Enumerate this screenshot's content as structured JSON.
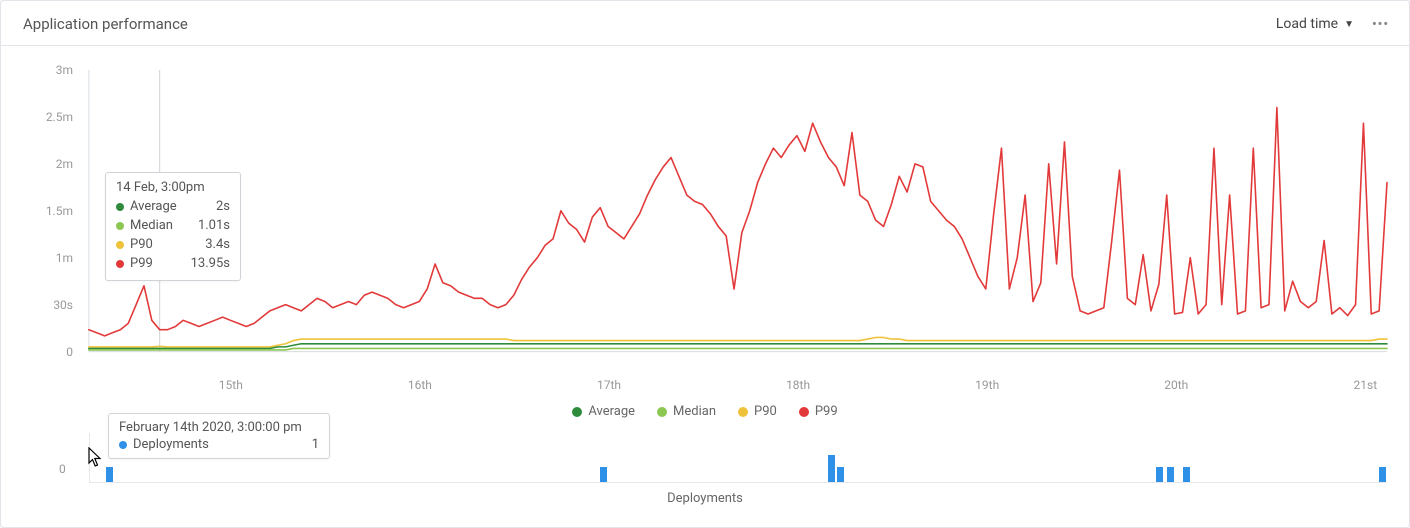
{
  "header": {
    "title": "Application performance",
    "dropdown_label": "Load time"
  },
  "legend": [
    {
      "label": "Average",
      "color": "#2e8b3c"
    },
    {
      "label": "Median",
      "color": "#8cc751"
    },
    {
      "label": "P90",
      "color": "#eec33a"
    },
    {
      "label": "P99",
      "color": "#e23a3a"
    }
  ],
  "y_ticks": [
    "0",
    "30s",
    "1m",
    "1.5m",
    "2m",
    "2.5m",
    "3m"
  ],
  "x_ticks": [
    "15th",
    "16th",
    "17th",
    "18th",
    "19th",
    "20th",
    "21st"
  ],
  "tooltip_main": {
    "heading": "14 Feb, 3:00pm",
    "rows": [
      {
        "label": "Average",
        "value": "2s",
        "color": "#2e8b3c"
      },
      {
        "label": "Median",
        "value": "1.01s",
        "color": "#8cc751"
      },
      {
        "label": "P90",
        "value": "3.4s",
        "color": "#eec33a"
      },
      {
        "label": "P99",
        "value": "13.95s",
        "color": "#e23a3a"
      }
    ]
  },
  "deployments": {
    "axis_label": "0",
    "title": "Deployments",
    "bars": [
      {
        "pos": 0.012,
        "h": 0.55
      },
      {
        "pos": 0.393,
        "h": 0.55
      },
      {
        "pos": 0.569,
        "h": 1.0
      },
      {
        "pos": 0.576,
        "h": 0.55
      },
      {
        "pos": 0.822,
        "h": 0.55
      },
      {
        "pos": 0.83,
        "h": 0.55
      },
      {
        "pos": 0.843,
        "h": 0.55
      },
      {
        "pos": 0.994,
        "h": 0.55
      }
    ]
  },
  "tooltip_deploy": {
    "heading": "February 14th 2020, 3:00:00 pm",
    "label": "Deployments",
    "value": "1"
  },
  "chart_data": {
    "type": "line",
    "title": "Application performance — Load time",
    "xlabel": "",
    "ylabel": "Load time",
    "y_ticks_seconds": [
      0,
      30,
      60,
      90,
      120,
      150,
      180
    ],
    "ylim": [
      0,
      180
    ],
    "x": [
      "14 Feb 06:00",
      "14 Feb 07:00",
      "14 Feb 08:00",
      "14 Feb 09:00",
      "14 Feb 10:00",
      "14 Feb 11:00",
      "14 Feb 12:00",
      "14 Feb 13:00",
      "14 Feb 14:00",
      "14 Feb 15:00",
      "14 Feb 16:00",
      "14 Feb 17:00",
      "14 Feb 18:00",
      "14 Feb 19:00",
      "14 Feb 20:00",
      "14 Feb 21:00",
      "14 Feb 22:00",
      "14 Feb 23:00",
      "15 Feb 00:00",
      "15 Feb 01:00",
      "15 Feb 02:00",
      "15 Feb 03:00",
      "15 Feb 04:00",
      "15 Feb 05:00",
      "15 Feb 06:00",
      "15 Feb 07:00",
      "15 Feb 08:00",
      "15 Feb 09:00",
      "15 Feb 10:00",
      "15 Feb 11:00",
      "15 Feb 12:00",
      "15 Feb 13:00",
      "15 Feb 14:00",
      "15 Feb 15:00",
      "15 Feb 16:00",
      "15 Feb 17:00",
      "15 Feb 18:00",
      "15 Feb 19:00",
      "15 Feb 20:00",
      "15 Feb 21:00",
      "15 Feb 22:00",
      "15 Feb 23:00",
      "16 Feb 00:00",
      "16 Feb 01:00",
      "16 Feb 02:00",
      "16 Feb 03:00",
      "16 Feb 04:00",
      "16 Feb 05:00",
      "16 Feb 06:00",
      "16 Feb 07:00",
      "16 Feb 08:00",
      "16 Feb 09:00",
      "16 Feb 10:00",
      "16 Feb 11:00",
      "16 Feb 12:00",
      "16 Feb 13:00",
      "16 Feb 14:00",
      "16 Feb 15:00",
      "16 Feb 16:00",
      "16 Feb 17:00",
      "16 Feb 18:00",
      "16 Feb 19:00",
      "16 Feb 20:00",
      "16 Feb 21:00",
      "16 Feb 22:00",
      "16 Feb 23:00",
      "17 Feb 00:00",
      "17 Feb 01:00",
      "17 Feb 02:00",
      "17 Feb 03:00",
      "17 Feb 04:00",
      "17 Feb 05:00",
      "17 Feb 06:00",
      "17 Feb 07:00",
      "17 Feb 08:00",
      "17 Feb 09:00",
      "17 Feb 10:00",
      "17 Feb 11:00",
      "17 Feb 12:00",
      "17 Feb 13:00",
      "17 Feb 14:00",
      "17 Feb 15:00",
      "17 Feb 16:00",
      "17 Feb 17:00",
      "17 Feb 18:00",
      "17 Feb 19:00",
      "17 Feb 20:00",
      "17 Feb 21:00",
      "17 Feb 22:00",
      "17 Feb 23:00",
      "18 Feb 00:00",
      "18 Feb 01:00",
      "18 Feb 02:00",
      "18 Feb 03:00",
      "18 Feb 04:00",
      "18 Feb 05:00",
      "18 Feb 06:00",
      "18 Feb 07:00",
      "18 Feb 08:00",
      "18 Feb 09:00",
      "18 Feb 10:00",
      "18 Feb 11:00",
      "18 Feb 12:00",
      "18 Feb 13:00",
      "18 Feb 14:00",
      "18 Feb 15:00",
      "18 Feb 16:00",
      "18 Feb 17:00",
      "18 Feb 18:00",
      "18 Feb 19:00",
      "18 Feb 20:00",
      "18 Feb 21:00",
      "18 Feb 22:00",
      "18 Feb 23:00",
      "19 Feb 00:00",
      "19 Feb 01:00",
      "19 Feb 02:00",
      "19 Feb 03:00",
      "19 Feb 04:00",
      "19 Feb 05:00",
      "19 Feb 06:00",
      "19 Feb 07:00",
      "19 Feb 08:00",
      "19 Feb 09:00",
      "19 Feb 10:00",
      "19 Feb 11:00",
      "19 Feb 12:00",
      "19 Feb 13:00",
      "19 Feb 14:00",
      "19 Feb 15:00",
      "19 Feb 16:00",
      "19 Feb 17:00",
      "19 Feb 18:00",
      "19 Feb 19:00",
      "19 Feb 20:00",
      "19 Feb 21:00",
      "19 Feb 22:00",
      "19 Feb 23:00",
      "20 Feb 00:00",
      "20 Feb 01:00",
      "20 Feb 02:00",
      "20 Feb 03:00",
      "20 Feb 04:00",
      "20 Feb 05:00",
      "20 Feb 06:00",
      "20 Feb 07:00",
      "20 Feb 08:00",
      "20 Feb 09:00",
      "20 Feb 10:00",
      "20 Feb 11:00",
      "20 Feb 12:00",
      "20 Feb 13:00",
      "20 Feb 14:00",
      "20 Feb 15:00",
      "20 Feb 16:00",
      "20 Feb 17:00",
      "20 Feb 18:00",
      "20 Feb 19:00",
      "20 Feb 20:00",
      "20 Feb 21:00",
      "20 Feb 22:00",
      "20 Feb 23:00",
      "21 Feb 00:00",
      "21 Feb 01:00",
      "21 Feb 02:00",
      "21 Feb 03:00"
    ],
    "series": [
      {
        "name": "Average",
        "color": "#2e8b3c",
        "values": [
          2,
          2,
          2,
          2,
          2,
          2,
          2,
          2,
          2,
          2,
          2,
          2,
          2,
          2,
          2,
          2,
          2,
          2,
          2,
          2,
          2,
          2,
          2,
          2,
          3,
          3,
          4,
          5,
          5,
          5,
          5,
          5,
          5,
          5,
          5,
          5,
          5,
          5,
          5,
          5,
          5,
          5,
          5,
          5,
          5,
          5,
          5,
          5,
          5,
          5,
          5,
          5,
          5,
          5,
          5,
          5,
          5,
          5,
          5,
          5,
          5,
          5,
          5,
          5,
          5,
          5,
          5,
          5,
          5,
          5,
          5,
          5,
          5,
          5,
          5,
          5,
          5,
          5,
          5,
          5,
          5,
          5,
          5,
          5,
          5,
          5,
          5,
          5,
          5,
          5,
          5,
          5,
          5,
          5,
          5,
          5,
          5,
          5,
          5,
          5,
          5,
          5,
          5,
          5,
          5,
          5,
          5,
          5,
          5,
          5,
          5,
          5,
          5,
          5,
          5,
          5,
          5,
          5,
          5,
          5,
          5,
          5,
          5,
          5,
          5,
          5,
          5,
          5,
          5,
          5,
          5,
          5,
          5,
          5,
          5,
          5,
          5,
          5,
          5,
          5,
          5,
          5,
          5,
          5,
          5,
          5,
          5,
          5,
          5,
          5,
          5,
          5,
          5,
          5,
          5,
          5,
          5,
          5,
          5,
          5,
          5,
          5,
          5,
          5,
          5,
          5
        ]
      },
      {
        "name": "Median",
        "color": "#8cc751",
        "values": [
          1,
          1,
          1,
          1,
          1,
          1,
          1,
          1,
          1,
          1.01,
          1,
          1,
          1,
          1,
          1,
          1,
          1,
          1,
          1,
          1,
          1,
          1,
          1,
          1,
          1,
          1,
          2,
          2,
          2,
          2,
          2,
          2,
          2,
          2,
          2,
          2,
          2,
          2,
          2,
          2,
          2,
          2,
          2,
          2,
          2,
          2,
          2,
          2,
          2,
          2,
          2,
          2,
          2,
          2,
          2,
          2,
          2,
          2,
          2,
          2,
          2,
          2,
          2,
          2,
          2,
          2,
          2,
          2,
          2,
          2,
          2,
          2,
          2,
          2,
          2,
          2,
          2,
          2,
          2,
          2,
          2,
          2,
          2,
          2,
          2,
          2,
          2,
          2,
          2,
          2,
          2,
          2,
          2,
          2,
          2,
          2,
          2,
          2,
          2,
          2,
          2,
          2,
          2,
          2,
          2,
          2,
          2,
          2,
          2,
          2,
          2,
          2,
          2,
          2,
          2,
          2,
          2,
          2,
          2,
          2,
          2,
          2,
          2,
          2,
          2,
          2,
          2,
          2,
          2,
          2,
          2,
          2,
          2,
          2,
          2,
          2,
          2,
          2,
          2,
          2,
          2,
          2,
          2,
          2,
          2,
          2,
          2,
          2,
          2,
          2,
          2,
          2,
          2,
          2,
          2,
          2,
          2,
          2,
          2,
          2,
          2,
          2,
          2,
          2,
          2,
          2
        ]
      },
      {
        "name": "P90",
        "color": "#eec33a",
        "values": [
          3,
          3,
          3,
          3,
          3,
          3,
          3,
          3,
          3,
          3.4,
          3,
          3,
          3,
          3,
          3,
          3,
          3,
          3,
          3,
          3,
          3,
          3,
          3,
          3,
          4,
          5,
          7,
          8,
          8,
          8,
          8,
          8,
          8,
          8,
          8,
          8,
          8,
          8,
          8,
          8,
          8,
          8,
          8,
          8,
          8,
          8,
          8,
          8,
          8,
          8,
          8,
          8,
          8,
          8,
          7,
          7,
          7,
          7,
          7,
          7,
          7,
          7,
          7,
          7,
          7,
          7,
          7,
          7,
          7,
          7,
          7,
          7,
          7,
          7,
          7,
          7,
          7,
          7,
          7,
          7,
          7,
          7,
          7,
          7,
          7,
          7,
          7,
          7,
          7,
          7,
          7,
          7,
          7,
          7,
          7,
          7,
          7,
          7,
          7,
          8,
          9,
          9,
          8,
          8,
          7,
          7,
          7,
          7,
          7,
          7,
          7,
          7,
          7,
          7,
          7,
          7,
          7,
          7,
          7,
          7,
          7,
          7,
          7,
          7,
          7,
          7,
          7,
          7,
          7,
          7,
          7,
          7,
          7,
          7,
          7,
          7,
          7,
          7,
          7,
          7,
          7,
          7,
          7,
          7,
          7,
          7,
          7,
          7,
          7,
          7,
          7,
          7,
          7,
          7,
          7,
          7,
          7,
          7,
          7,
          7,
          7,
          7,
          7,
          7,
          8,
          8
        ]
      },
      {
        "name": "P99",
        "color": "#e23a3a",
        "values": [
          14,
          12,
          10,
          12,
          14,
          18,
          30,
          42,
          20,
          13.95,
          14,
          16,
          20,
          18,
          16,
          18,
          20,
          22,
          20,
          18,
          16,
          18,
          22,
          26,
          28,
          30,
          28,
          26,
          30,
          34,
          32,
          28,
          30,
          32,
          30,
          36,
          38,
          36,
          34,
          30,
          28,
          30,
          32,
          40,
          56,
          44,
          42,
          38,
          36,
          34,
          34,
          30,
          28,
          30,
          36,
          46,
          54,
          60,
          68,
          72,
          90,
          82,
          78,
          70,
          86,
          92,
          80,
          76,
          72,
          80,
          88,
          100,
          110,
          118,
          124,
          112,
          100,
          96,
          94,
          88,
          80,
          74,
          40,
          76,
          90,
          108,
          120,
          130,
          124,
          132,
          138,
          128,
          146,
          134,
          124,
          118,
          106,
          140,
          100,
          96,
          84,
          80,
          94,
          112,
          102,
          120,
          118,
          96,
          90,
          84,
          80,
          72,
          60,
          48,
          40,
          88,
          130,
          40,
          60,
          100,
          32,
          44,
          120,
          56,
          134,
          48,
          26,
          24,
          26,
          28,
          70,
          116,
          34,
          30,
          62,
          26,
          43,
          100,
          24,
          25,
          60,
          24,
          30,
          130,
          30,
          100,
          24,
          26,
          130,
          28,
          30,
          156,
          26,
          45,
          32,
          28,
          32,
          71,
          24,
          28,
          23,
          30,
          146,
          24,
          26,
          108
        ]
      }
    ]
  }
}
